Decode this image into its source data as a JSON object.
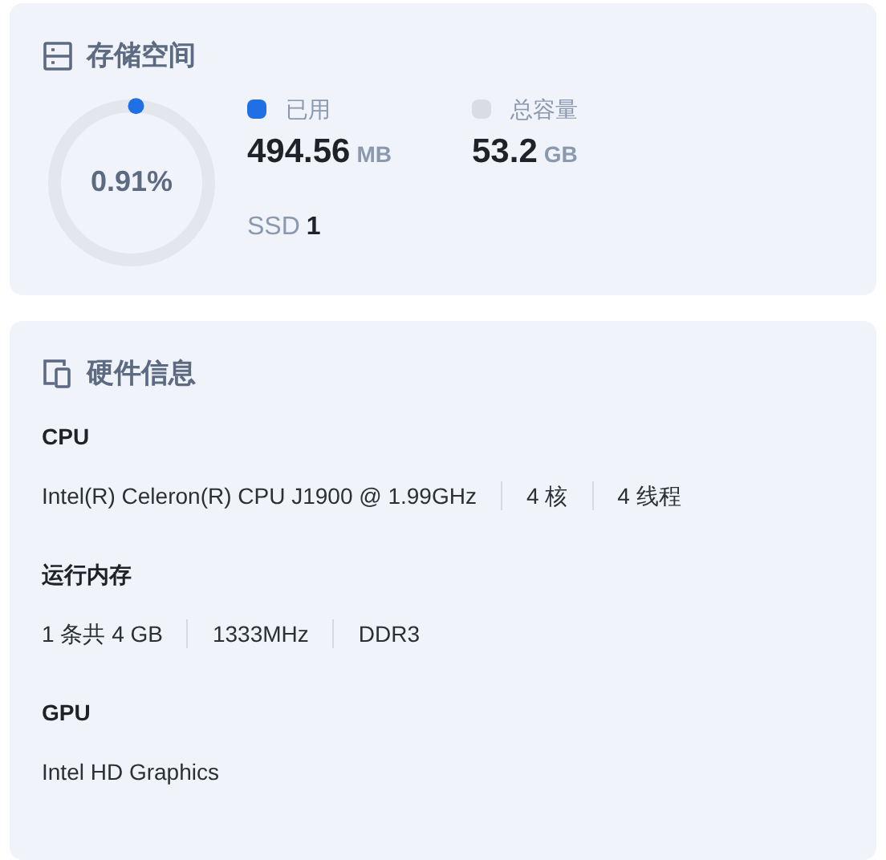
{
  "storage": {
    "title": "存储空间",
    "usage": {
      "percent": "0.91%"
    },
    "legend": [
      {
        "label": "已用",
        "color": "#1f6fe5",
        "value": "494.56",
        "unit": "MB"
      },
      {
        "label": "总容量",
        "color": "#d9dde3",
        "value": "53.2",
        "unit": "GB"
      }
    ],
    "disk": {
      "label": "SSD",
      "count": "1"
    }
  },
  "hardware": {
    "title": "硬件信息",
    "sections": [
      {
        "heading": "CPU",
        "values": [
          "Intel(R) Celeron(R) CPU J1900 @ 1.99GHz",
          "4 核",
          "4 线程"
        ]
      },
      {
        "heading": "运行内存",
        "values": [
          "1 条共 4 GB",
          "1333MHz",
          "DDR3"
        ]
      },
      {
        "heading": "GPU",
        "values": [
          "Intel HD Graphics"
        ]
      }
    ]
  }
}
